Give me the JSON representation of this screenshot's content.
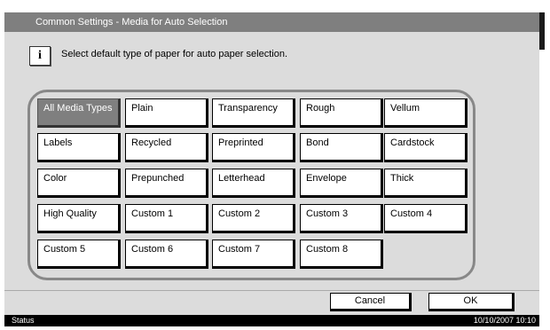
{
  "title": "Common Settings - Media for Auto Selection",
  "info": {
    "icon": "info-icon",
    "icon_glyph": "i",
    "message": "Select default type of paper for auto paper selection."
  },
  "media_types": [
    [
      "All Media Types",
      "Plain",
      "Transparency",
      "Rough",
      "Vellum"
    ],
    [
      "Labels",
      "Recycled",
      "Preprinted",
      "Bond",
      "Cardstock"
    ],
    [
      "Color",
      "Prepunched",
      "Letterhead",
      "Envelope",
      "Thick"
    ],
    [
      "High Quality",
      "Custom 1",
      "Custom 2",
      "Custom 3",
      "Custom 4"
    ],
    [
      "Custom 5",
      "Custom 6",
      "Custom 7",
      "Custom 8"
    ]
  ],
  "selected_media": "All Media Types",
  "actions": {
    "cancel_label": "Cancel",
    "ok_label": "OK"
  },
  "status": {
    "label": "Status",
    "datetime": "10/10/2007 10:10"
  },
  "colors": {
    "title_bar": "#7f7f7f",
    "screen_bg": "#dcdcdc",
    "selected_button": "#7f7f7f",
    "status_bar": "#000000"
  }
}
